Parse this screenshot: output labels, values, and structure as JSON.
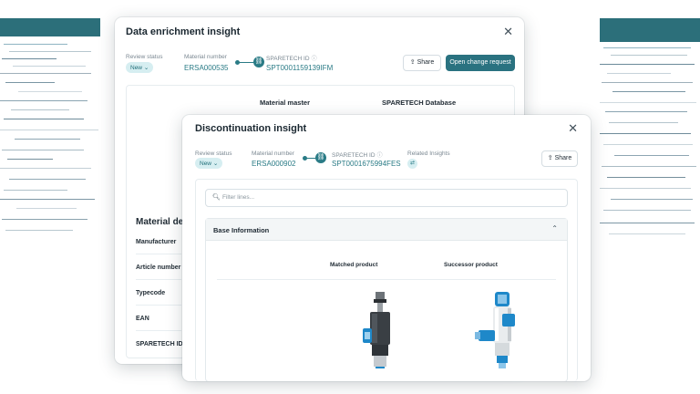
{
  "background": {
    "accent": "#2c6f7a"
  },
  "back_window": {
    "title": "Data enrichment insight",
    "review_status_label": "Review status",
    "review_status_value": "New",
    "material_number_label": "Material number",
    "material_number_value": "ERSA000535",
    "sparetech_id_label": "SPARETECH ID",
    "sparetech_id_value": "SPT0001159139IFM",
    "share_label": "Share",
    "open_change_request_label": "Open change request",
    "col_material_master": "Material master",
    "col_sparetech_database": "SPARETECH Database",
    "section_title": "Material deta",
    "rows": [
      "Manufacturer",
      "Article number",
      "Typecode",
      "EAN",
      "SPARETECH ID"
    ]
  },
  "front_window": {
    "title": "Discontinuation insight",
    "review_status_label": "Review status",
    "review_status_value": "New",
    "material_number_label": "Material number",
    "material_number_value": "ERSA000902",
    "sparetech_id_label": "SPARETECH ID",
    "sparetech_id_value": "SPT0001675994FES",
    "related_insights_label": "Related Insights",
    "share_label": "Share",
    "filter_placeholder": "Filter lines...",
    "accordion_title": "Base Information",
    "col_matched_product": "Matched product",
    "col_successor_product": "Successor product"
  },
  "icons": {
    "close": "close-icon",
    "share": "share-icon",
    "search": "search-icon",
    "chevron": "chevron-up-icon",
    "link": "link-icon",
    "info": "info-icon",
    "related": "related-insights-icon"
  }
}
